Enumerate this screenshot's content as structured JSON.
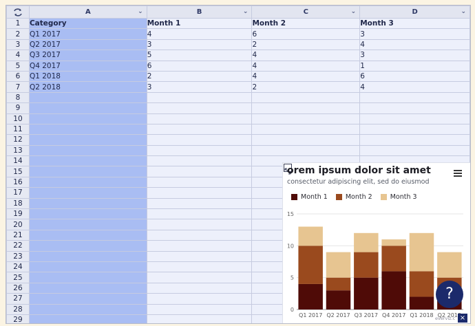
{
  "sheet": {
    "columns": [
      "A",
      "B",
      "C",
      "D"
    ],
    "row_numbers": [
      "1",
      "2",
      "3",
      "4",
      "5",
      "6",
      "7",
      "8",
      "9",
      "10",
      "11",
      "12",
      "13",
      "14",
      "15",
      "16",
      "17",
      "18",
      "19",
      "20",
      "21",
      "22",
      "23",
      "24",
      "25",
      "26",
      "27",
      "28",
      "29"
    ],
    "rows": [
      [
        "Category",
        "Month 1",
        "Month 2",
        "Month 3"
      ],
      [
        "Q1 2017",
        "4",
        "6",
        "3"
      ],
      [
        "Q2 2017",
        "3",
        "2",
        "4"
      ],
      [
        "Q3 2017",
        "5",
        "4",
        "3"
      ],
      [
        "Q4 2017",
        "6",
        "4",
        "1"
      ],
      [
        "Q1 2018",
        "2",
        "4",
        "6"
      ],
      [
        "Q2 2018",
        "3",
        "2",
        "4"
      ]
    ],
    "colors": {
      "selected_column": "#a9bdf3",
      "grid": "#edf0fb"
    }
  },
  "chart": {
    "title": "orem ipsum dolor sit amet",
    "subtitle": "consectetur adipiscing elit, sed do eiusmod",
    "menu_icon": "hamburger-menu-icon",
    "expand_icon": "expand-arrows-icon"
  },
  "chart_data": {
    "type": "bar",
    "stacked": true,
    "categories": [
      "Q1 2017",
      "Q2 2017",
      "Q3 2017",
      "Q4 2017",
      "Q1 2018",
      "Q2 2018"
    ],
    "series": [
      {
        "name": "Month 1",
        "values": [
          4,
          3,
          5,
          6,
          2,
          3
        ],
        "color": "#4f0b07"
      },
      {
        "name": "Month 2",
        "values": [
          6,
          2,
          4,
          4,
          4,
          2
        ],
        "color": "#9a4a1e"
      },
      {
        "name": "Month 3",
        "values": [
          3,
          4,
          3,
          1,
          6,
          4
        ],
        "color": "#e7c591"
      }
    ],
    "yticks": [
      "0",
      "5",
      "10",
      "15"
    ],
    "ylim": [
      0,
      15
    ],
    "legend": "top-left",
    "grid": true
  },
  "help": {
    "label": "?",
    "icon": "question-mark-icon"
  },
  "close": {
    "label": "×"
  },
  "credit": "everviz.c"
}
